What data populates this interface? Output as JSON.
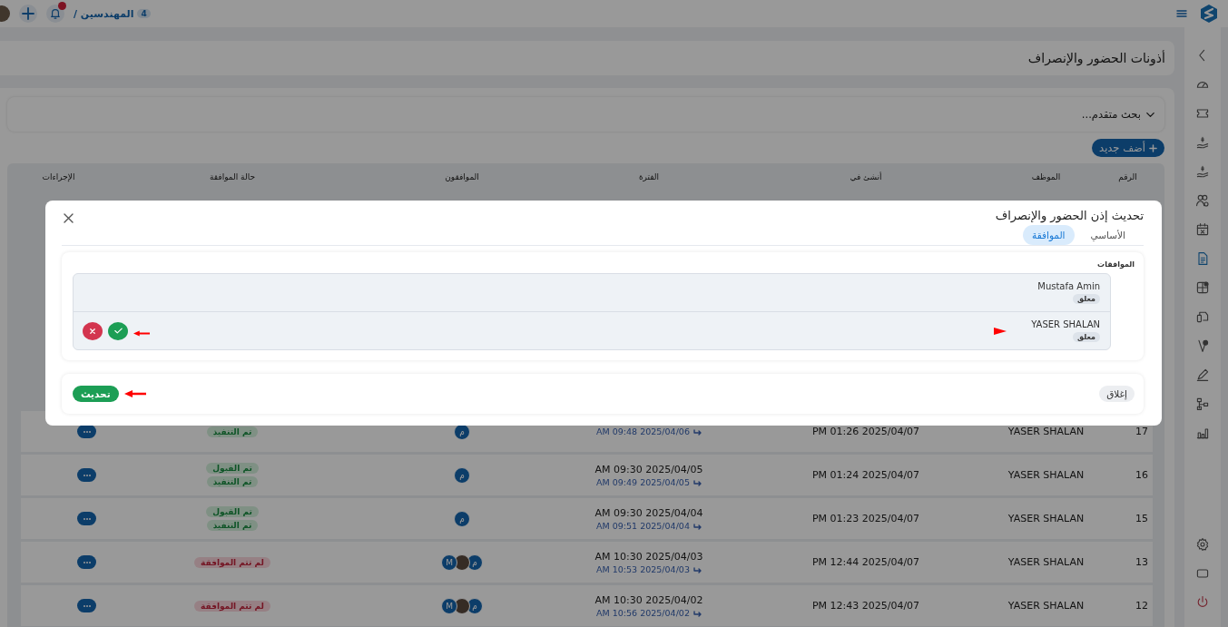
{
  "topbar": {
    "breadcrumb": {
      "label": "المهندسين /",
      "count": "4"
    }
  },
  "sidebar": {
    "items": [
      {
        "selected": false
      },
      {
        "selected": false
      },
      {
        "selected": false
      },
      {
        "selected": false
      },
      {
        "selected": false
      },
      {
        "selected": false
      },
      {
        "selected": true
      },
      {
        "selected": false
      },
      {
        "selected": false
      },
      {
        "selected": false
      },
      {
        "selected": false
      },
      {
        "selected": false
      },
      {
        "selected": false
      }
    ]
  },
  "page": {
    "title": "أذونات الحضور والإنصراف"
  },
  "search": {
    "label": "بحث متقدم..."
  },
  "add_button": {
    "label": "أضف جديد"
  },
  "table": {
    "columns": [
      "الرقم",
      "الموظف",
      "أنشئ في",
      "الفترة",
      "الموافقون",
      "حالة الموافقة",
      "الإجراءات"
    ],
    "rows": [
      {
        "number": "17",
        "employee": "YASER SHALAN",
        "created": "PM 01:26 2025/04/07",
        "period_end": "AM 09:48 2025/04/06",
        "approvers": [
          {
            "kind": "letter",
            "text": "م"
          }
        ],
        "status": [
          {
            "kind": "success",
            "text": "تم التنفيذ"
          }
        ]
      },
      {
        "number": "16",
        "employee": "YASER SHALAN",
        "created": "PM 01:24 2025/04/07",
        "period_start": "AM 09:30 2025/04/05",
        "period_end": "AM 09:49 2025/04/05",
        "approvers": [
          {
            "kind": "letter",
            "text": "م"
          }
        ],
        "status": [
          {
            "kind": "success",
            "text": "تم القبول"
          },
          {
            "kind": "success",
            "text": "تم التنفيذ"
          }
        ]
      },
      {
        "number": "15",
        "employee": "YASER SHALAN",
        "created": "PM 01:23 2025/04/07",
        "period_start": "AM 09:30 2025/04/04",
        "period_end": "AM 09:51 2025/04/04",
        "approvers": [
          {
            "kind": "letter",
            "text": "م"
          }
        ],
        "status": [
          {
            "kind": "success",
            "text": "تم القبول"
          },
          {
            "kind": "success",
            "text": "تم التنفيذ"
          }
        ]
      },
      {
        "number": "13",
        "employee": "YASER SHALAN",
        "created": "PM 12:44 2025/04/07",
        "period_start": "AM 10:30 2025/04/03",
        "period_end": "AM 10:53 2025/04/03",
        "approvers": [
          {
            "kind": "letter",
            "text": "م"
          },
          {
            "kind": "photo"
          },
          {
            "kind": "letter",
            "text": "M"
          }
        ],
        "status": [
          {
            "kind": "danger",
            "text": "لم تتم الموافقة"
          }
        ]
      },
      {
        "number": "12",
        "employee": "YASER SHALAN",
        "created": "PM 12:43 2025/04/07",
        "period_start": "AM 10:30 2025/04/02",
        "period_end": "AM 10:56 2025/04/02",
        "approvers": [
          {
            "kind": "letter",
            "text": "م"
          },
          {
            "kind": "photo"
          },
          {
            "kind": "letter",
            "text": "M"
          }
        ],
        "status": [
          {
            "kind": "danger",
            "text": "لم تتم الموافقة"
          }
        ]
      }
    ]
  },
  "modal": {
    "title": "تحديث إذن الحضور والإنصراف",
    "tabs": [
      {
        "label": "الأساسي",
        "selected": false
      },
      {
        "label": "الموافقة",
        "selected": true
      }
    ],
    "approvals": {
      "label": "الموافقات",
      "items": [
        {
          "name": "Mustafa Amin",
          "status": "معلق",
          "actionable": false
        },
        {
          "name": "YASER SHALAN",
          "status": "معلق",
          "actionable": true
        }
      ]
    },
    "buttons": {
      "close": "إغلاق",
      "update": "تحديث"
    }
  }
}
